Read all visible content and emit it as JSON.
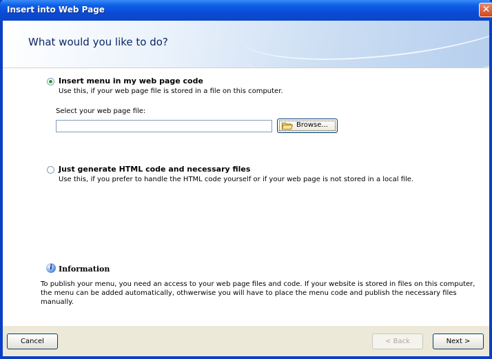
{
  "window": {
    "title": "Insert into Web Page"
  },
  "header": {
    "heading": "What would you like to do?"
  },
  "options": [
    {
      "label": "Insert menu in my web page code",
      "description": "Use this, if your web page file is stored in a file on this computer.",
      "checked": true
    },
    {
      "label": "Just generate HTML code and necessary files",
      "description": "Use this, if you prefer to handle the HTML code yourself or if your web page is not stored in a local file.",
      "checked": false
    }
  ],
  "file_select": {
    "label": "Select your web page file:",
    "value": "",
    "browse_label": "Browse..."
  },
  "information": {
    "title": "Information",
    "text": "To publish your menu, you need an access to your web page files and code. If your website is stored in files on this computer, the menu can be added automatically, othwerwise you will have to place the menu code and publish the necessary files manually."
  },
  "footer": {
    "cancel_label": "Cancel",
    "back_label": "< Back",
    "next_label": "Next >"
  }
}
